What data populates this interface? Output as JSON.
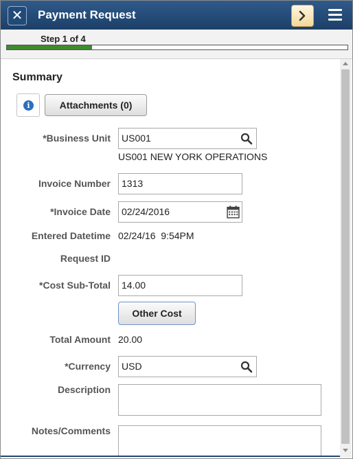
{
  "header": {
    "title": "Payment Request",
    "close_glyph": "✕",
    "next_glyph": ">"
  },
  "step": {
    "label": "Step 1 of 4",
    "progress_fraction": 0.25,
    "progress_color": "#3c8c2c"
  },
  "summary": {
    "title": "Summary",
    "attachments_label": "Attachments (0)"
  },
  "fields": {
    "business_unit": {
      "label": "*Business Unit",
      "value": "US001",
      "description": "US001 NEW YORK OPERATIONS"
    },
    "invoice_number": {
      "label": "Invoice Number",
      "value": "1313"
    },
    "invoice_date": {
      "label": "*Invoice Date",
      "value": "02/24/2016"
    },
    "entered_datetime": {
      "label": "Entered Datetime",
      "value": "02/24/16  9:54PM"
    },
    "request_id": {
      "label": "Request ID",
      "value": ""
    },
    "cost_subtotal": {
      "label": "*Cost Sub-Total",
      "value": "14.00"
    },
    "other_cost_label": "Other Cost",
    "total_amount": {
      "label": "Total Amount",
      "value": "20.00"
    },
    "currency": {
      "label": "*Currency",
      "value": "USD"
    },
    "description": {
      "label": "Description",
      "value": ""
    },
    "notes": {
      "label": "Notes/Comments",
      "value": ""
    }
  },
  "icons": {
    "close": "close-icon",
    "next": "chevron-right-icon",
    "menu": "hamburger-menu-icon",
    "info": "info-icon",
    "lookup": "search-icon",
    "calendar": "calendar-icon"
  },
  "colors": {
    "header_bg": "#1c3f68",
    "accent_next": "#f3d89a",
    "info_blue": "#2a6fbe"
  }
}
